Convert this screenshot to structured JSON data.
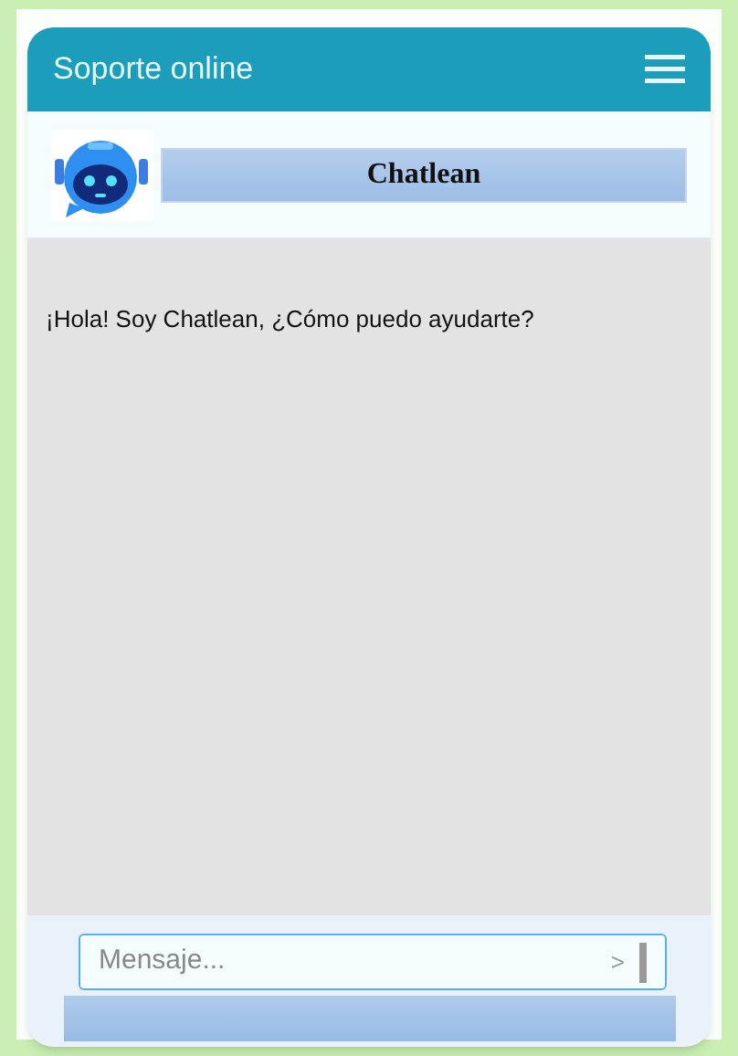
{
  "header": {
    "title": "Soporte online"
  },
  "bot": {
    "name": "Chatlean"
  },
  "messages": [
    {
      "text": "¡Hola! Soy Chatlean, ¿Cómo puedo ayudarte?"
    }
  ],
  "composer": {
    "placeholder": "Mensaje...",
    "send": ">"
  }
}
